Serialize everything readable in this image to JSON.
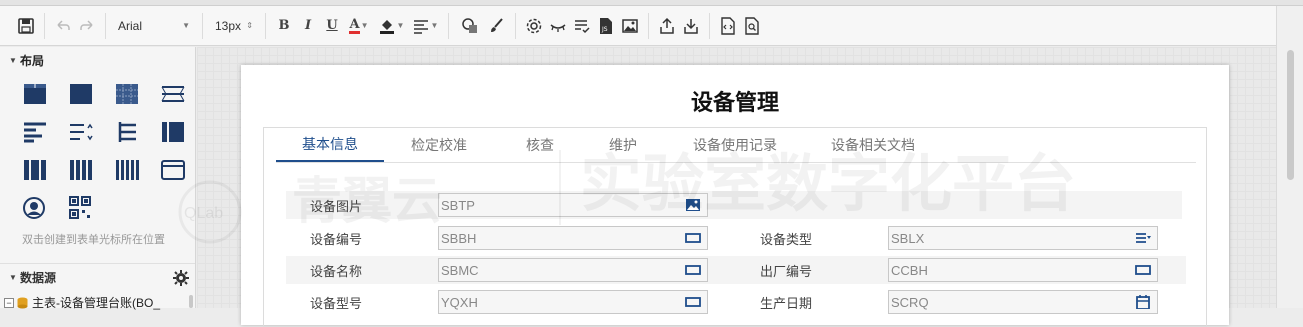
{
  "toolbar": {
    "font_family": "Arial",
    "font_size": "13px",
    "bold": "B",
    "italic": "I",
    "underline": "U",
    "font_color_letter": "A"
  },
  "left_panel": {
    "layout_title": "布局",
    "layout_hint": "双击创建到表单光标所在位置",
    "datasource_title": "数据源",
    "tree_item": "主表-设备管理台账(BO_"
  },
  "page": {
    "title": "设备管理",
    "tabs": [
      {
        "label": "基本信息",
        "active": true
      },
      {
        "label": "检定校准",
        "active": false
      },
      {
        "label": "核查",
        "active": false
      },
      {
        "label": "维护",
        "active": false
      },
      {
        "label": "设备使用记录",
        "active": false
      },
      {
        "label": "设备相关文档",
        "active": false
      }
    ],
    "form": {
      "photo_label": "设备图片",
      "photo_value": "SBTP",
      "code_label": "设备编号",
      "code_value": "SBBH",
      "type_label": "设备类型",
      "type_value": "SBLX",
      "name_label": "设备名称",
      "name_value": "SBMC",
      "factory_label": "出厂编号",
      "factory_value": "CCBH",
      "model_label": "设备型号",
      "model_value": "YQXH",
      "date_label": "生产日期",
      "date_value": "SCRQ"
    }
  },
  "watermark": {
    "brand": "QLab",
    "company": "青翼云",
    "platform": "实验室数字化平台"
  },
  "colors": {
    "accent": "#1f4e8c",
    "icon_navy": "#1f3a66"
  }
}
